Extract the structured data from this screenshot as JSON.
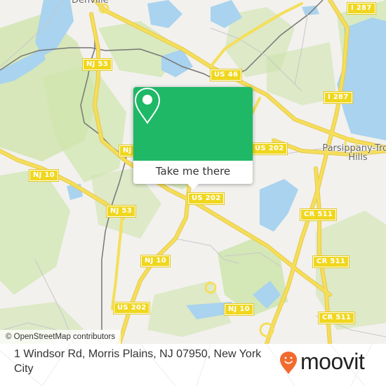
{
  "map": {
    "place_labels": [
      {
        "id": "denville",
        "text": "Denville"
      },
      {
        "id": "parsippany",
        "text": "Parsippany-Troy Hills"
      }
    ],
    "road_shields": [
      {
        "id": "nj53-north",
        "text": "NJ 53"
      },
      {
        "id": "us46",
        "text": "US 46"
      },
      {
        "id": "i287-north",
        "text": "I 287"
      },
      {
        "id": "i287-mid",
        "text": "I 287"
      },
      {
        "id": "nj10-west",
        "text": "NJ 10"
      },
      {
        "id": "nj-partial",
        "text": "NJ"
      },
      {
        "id": "us202-east",
        "text": "US 202"
      },
      {
        "id": "us202-center",
        "text": "US 202"
      },
      {
        "id": "nj53-south",
        "text": "NJ 53"
      },
      {
        "id": "cr511-north",
        "text": "CR 511"
      },
      {
        "id": "nj10-center",
        "text": "NJ 10"
      },
      {
        "id": "cr511-mid",
        "text": "CR 511"
      },
      {
        "id": "us202-south",
        "text": "US 202"
      },
      {
        "id": "nj10-east",
        "text": "NJ 10"
      },
      {
        "id": "cr511-south",
        "text": "CR 511"
      }
    ],
    "colors": {
      "land": "#f2f1ee",
      "park": "#cfe5ad",
      "water": "#a9d3ee",
      "road": "#f5de5a",
      "road_casing": "#e8c94a",
      "rail": "#777777",
      "popup_green": "#1fb866"
    }
  },
  "popup": {
    "icon": "map-pin-icon",
    "button_label": "Take me there"
  },
  "attribution": "© OpenStreetMap contributors",
  "footer": {
    "address": "1 Windsor Rd, Morris Plains, NJ 07950, New York City",
    "logo_text": "moovit",
    "logo_color": "#f26a2e"
  }
}
